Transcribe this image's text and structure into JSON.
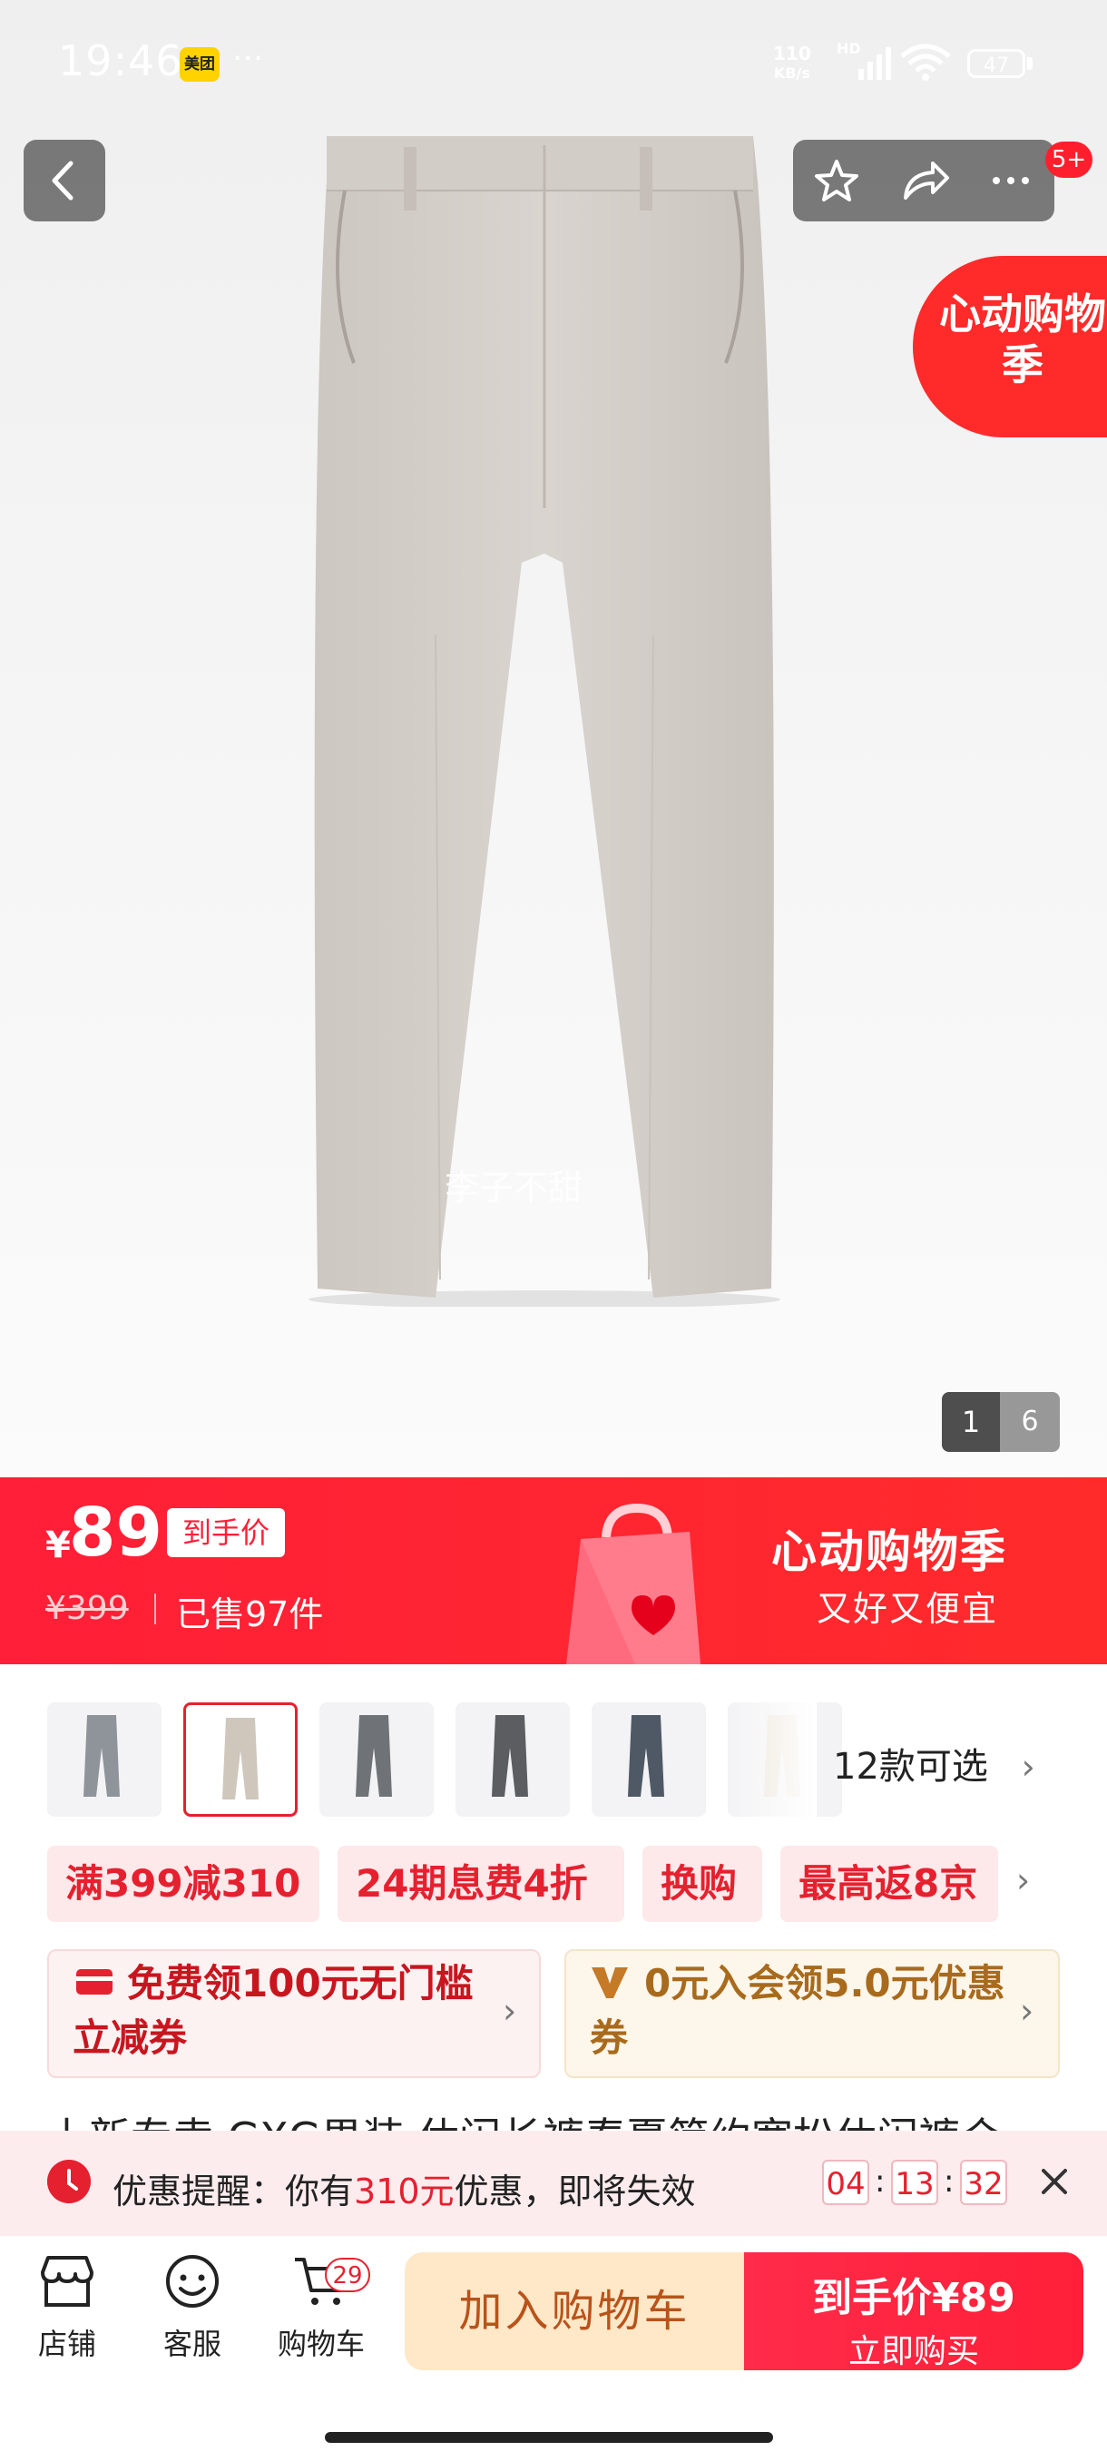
{
  "status_bar": {
    "time": "19:46",
    "app_badge": "美团",
    "more": "···",
    "net_speed": "110",
    "net_unit": "KB/s",
    "hd": "HD",
    "battery": "47"
  },
  "gallery": {
    "watermark": "李子不甜",
    "current_page": "1",
    "total_pages": "6"
  },
  "header": {
    "notification_count": "5+",
    "promo_float": "心动购物季"
  },
  "price": {
    "currency": "¥",
    "value": "89",
    "tag": "到手价",
    "original": "¥399",
    "sold": "已售97件"
  },
  "banner": {
    "title": "心动购物季",
    "subtitle": "又好又便宜"
  },
  "variants": {
    "count_label": "12款可选",
    "thumbnails": [
      {
        "color": "#8f949b",
        "selected": false
      },
      {
        "color": "#cfc6bc",
        "selected": true
      },
      {
        "color": "#6f7378",
        "selected": false
      },
      {
        "color": "#5b5d60",
        "selected": false
      },
      {
        "color": "#4f5966",
        "selected": false
      },
      {
        "color": "#ece5da",
        "selected": false
      }
    ]
  },
  "promos": {
    "chips": [
      "满399减310",
      "24期息费4折",
      "换购",
      "最高返8京"
    ]
  },
  "coupons": [
    {
      "icon": "coupon-icon",
      "text": "免费领100元无门槛立减券",
      "color": "#c8161f"
    },
    {
      "icon": "vip-v-icon",
      "text": "0元入会领5.0元优惠券",
      "color": "#a86a1c"
    }
  ],
  "title_peek": "上新专卖 GXG男装 休闲长裤春夏简约宽松休闲裤合",
  "reminder": {
    "prefix": "优惠提醒：你有",
    "amount": "310元",
    "suffix": "优惠，即将失效",
    "hours": "04",
    "minutes": "13",
    "seconds": "32"
  },
  "bottom_bar": {
    "store": "店铺",
    "service": "客服",
    "cart": "购物车",
    "cart_count": "29",
    "add_to_cart": "加入购物车",
    "buy_line1": "到手价¥89",
    "buy_line2": "立即购买"
  },
  "colors": {
    "accent_red": "#e5212f",
    "banner_red": "#ff1f38",
    "add_cart_bg": "#ffe8c8"
  }
}
